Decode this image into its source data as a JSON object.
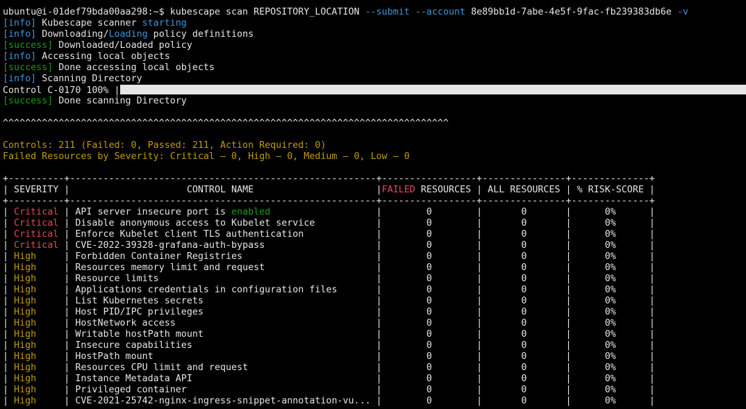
{
  "prompt": {
    "user_host": "ubuntu@i-01def79bda00aa298:~$",
    "command": "kubescape scan REPOSITORY_LOCATION",
    "flag_submit": "--submit",
    "flag_account": "--account",
    "account_id": "8e89bb1d-7abe-4e5f-9fac-fb239383db6e",
    "flag_verbose": "-v"
  },
  "log": [
    {
      "tag": "[info]",
      "segments": [
        {
          "text": "Kubescape scanner "
        },
        {
          "text": "starting",
          "color": "cyan"
        }
      ]
    },
    {
      "tag": "[info]",
      "segments": [
        {
          "text": "Downloading/"
        },
        {
          "text": "Loading",
          "color": "cyan"
        },
        {
          "text": " policy definitions"
        }
      ]
    },
    {
      "tag": "[success]",
      "segments": [
        {
          "text": "Downloaded/Loaded policy"
        }
      ]
    },
    {
      "tag": "[info]",
      "segments": [
        {
          "text": "Accessing local objects"
        }
      ]
    },
    {
      "tag": "[success]",
      "segments": [
        {
          "text": "Done accessing local objects"
        }
      ]
    },
    {
      "tag": "[info]",
      "segments": [
        {
          "text": "Scanning Directory"
        }
      ]
    }
  ],
  "progress": {
    "label": "Control C-0170 100% |",
    "percent": 100
  },
  "done_line": {
    "tag": "[success]",
    "text": "Done scanning Directory"
  },
  "separator": "^^^^^^^^^^^^^^^^^^^^^^^^^^^^^^^^^^^^^^^^^^^^^^^^^^^^^^^^^^^^^^^^^^^^^^^^^^^^^^^^",
  "summary": {
    "controls": "Controls: 211 (Failed: 0, Passed: 211, Action Required: 0)",
    "failed_resources": "Failed Resources by Severity: Critical — 0, High — 0, Medium — 0, Low — 0"
  },
  "table": {
    "border": "+----------+-------------------------------------------------------+-----------------+---------------+--------------+",
    "headers": {
      "severity": "SEVERITY",
      "control_name": "CONTROL NAME",
      "failed_word": "FAILED",
      "resources_word": "RESOURCES",
      "all_resources": "ALL RESOURCES",
      "risk_score": "% RISK-SCORE"
    },
    "rows": [
      {
        "severity": "Critical",
        "name": [
          {
            "text": "API server insecure port is "
          },
          {
            "text": "enabled",
            "color": "green"
          }
        ],
        "failed": "0",
        "all": "0",
        "risk": "0%"
      },
      {
        "severity": "Critical",
        "name": [
          {
            "text": "Disable anonymous access to Kubelet service"
          }
        ],
        "failed": "0",
        "all": "0",
        "risk": "0%"
      },
      {
        "severity": "Critical",
        "name": [
          {
            "text": "Enforce Kubelet client TLS authentication"
          }
        ],
        "failed": "0",
        "all": "0",
        "risk": "0%"
      },
      {
        "severity": "Critical",
        "name": [
          {
            "text": "CVE-2022-39328-grafana-auth-bypass"
          }
        ],
        "failed": "0",
        "all": "0",
        "risk": "0%"
      },
      {
        "severity": "High",
        "name": [
          {
            "text": "Forbidden Container Registries"
          }
        ],
        "failed": "0",
        "all": "0",
        "risk": "0%"
      },
      {
        "severity": "High",
        "name": [
          {
            "text": "Resources memory limit and request"
          }
        ],
        "failed": "0",
        "all": "0",
        "risk": "0%"
      },
      {
        "severity": "High",
        "name": [
          {
            "text": "Resource limits"
          }
        ],
        "failed": "0",
        "all": "0",
        "risk": "0%"
      },
      {
        "severity": "High",
        "name": [
          {
            "text": "Applications credentials in configuration files"
          }
        ],
        "failed": "0",
        "all": "0",
        "risk": "0%"
      },
      {
        "severity": "High",
        "name": [
          {
            "text": "List Kubernetes secrets"
          }
        ],
        "failed": "0",
        "all": "0",
        "risk": "0%"
      },
      {
        "severity": "High",
        "name": [
          {
            "text": "Host PID/IPC privileges"
          }
        ],
        "failed": "0",
        "all": "0",
        "risk": "0%"
      },
      {
        "severity": "High",
        "name": [
          {
            "text": "HostNetwork access"
          }
        ],
        "failed": "0",
        "all": "0",
        "risk": "0%"
      },
      {
        "severity": "High",
        "name": [
          {
            "text": "Writable hostPath mount"
          }
        ],
        "failed": "0",
        "all": "0",
        "risk": "0%"
      },
      {
        "severity": "High",
        "name": [
          {
            "text": "Insecure capabilities"
          }
        ],
        "failed": "0",
        "all": "0",
        "risk": "0%"
      },
      {
        "severity": "High",
        "name": [
          {
            "text": "HostPath mount"
          }
        ],
        "failed": "0",
        "all": "0",
        "risk": "0%"
      },
      {
        "severity": "High",
        "name": [
          {
            "text": "Resources CPU limit and request"
          }
        ],
        "failed": "0",
        "all": "0",
        "risk": "0%"
      },
      {
        "severity": "High",
        "name": [
          {
            "text": "Instance Metadata API"
          }
        ],
        "failed": "0",
        "all": "0",
        "risk": "0%"
      },
      {
        "severity": "High",
        "name": [
          {
            "text": "Privileged container"
          }
        ],
        "failed": "0",
        "all": "0",
        "risk": "0%"
      },
      {
        "severity": "High",
        "name": [
          {
            "text": "CVE-2021-25742-nginx-ingress-snippet-annotation-vu..."
          }
        ],
        "failed": "0",
        "all": "0",
        "risk": "0%"
      }
    ]
  },
  "colors": {
    "background": "#000000",
    "foreground": "#e6e6e6",
    "green": "#13a10e",
    "cyan": "#3a96dd",
    "red": "#e74856",
    "yellow": "#c19c00"
  }
}
